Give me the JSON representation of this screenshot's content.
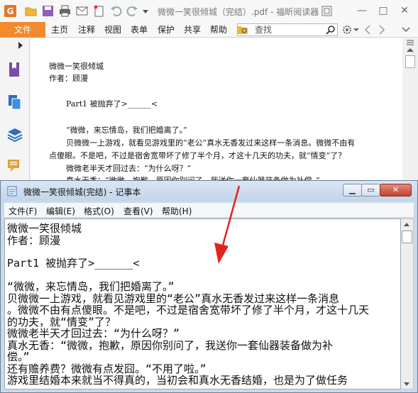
{
  "foxit": {
    "title": "微微一笑很倾城（完结）.pdf - 福昕阅读器",
    "menu": {
      "file": "文件",
      "items": [
        "主页",
        "注释",
        "视图",
        "表单",
        "保护",
        "共享",
        "帮助"
      ]
    },
    "search": {
      "placeholder": "查找"
    },
    "pdf_lines": [
      "微微一笑很倾城",
      "作者：顾漫",
      "Part1 被抛弃了>______<",
      "“微微，来忘情岛，我们把婚离了。”",
      "贝微微一上游戏，就看见游戏里的“老公”真水无香发过来这样一条消息。微微不由有",
      "点傻眼。不是吧，不过是宿舍宽带坏了修了半个月，才这十几天的功夫，就“情变”了？",
      "微微老半天才回过去：“为什么呀？”",
      "真水无香：“微微，抱歉，原因你别问了，我送你一套仙器装备做为补偿。”"
    ],
    "colors": {
      "file_tab": "#f28a2e"
    }
  },
  "notepad": {
    "title": "微微一笑很倾城(完结) - 记事本",
    "menu": [
      "文件(F)",
      "编辑(E)",
      "格式(O)",
      "查看(V)",
      "帮助(H)"
    ],
    "lines": [
      "微微一笑很倾城",
      "作者：顾漫",
      "",
      "    Part1 被抛弃了>______<",
      "",
      "    “微微，来忘情岛，我们把婚离了。”",
      "    贝微微一上游戏，就看见游戏里的“老公”真水无香发过来这样一条消息",
      "。微微不由有点傻眼。不是吧，不过是宿舍宽带坏了修了半个月，才这十几天",
      "的功夫，就“情变”了？",
      "    微微老半天才回过去：“为什么呀？”",
      "    真水无香：“微微，抱歉，原因你别问了，我送你一套仙器装备做为补",
      "偿。”",
      "    还有赡养费？微微有点发囧。“不用了啦。”",
      "    游戏里结婚本来就当不得真的，当初会和真水无香结婚，也是为了做任务"
    ]
  }
}
